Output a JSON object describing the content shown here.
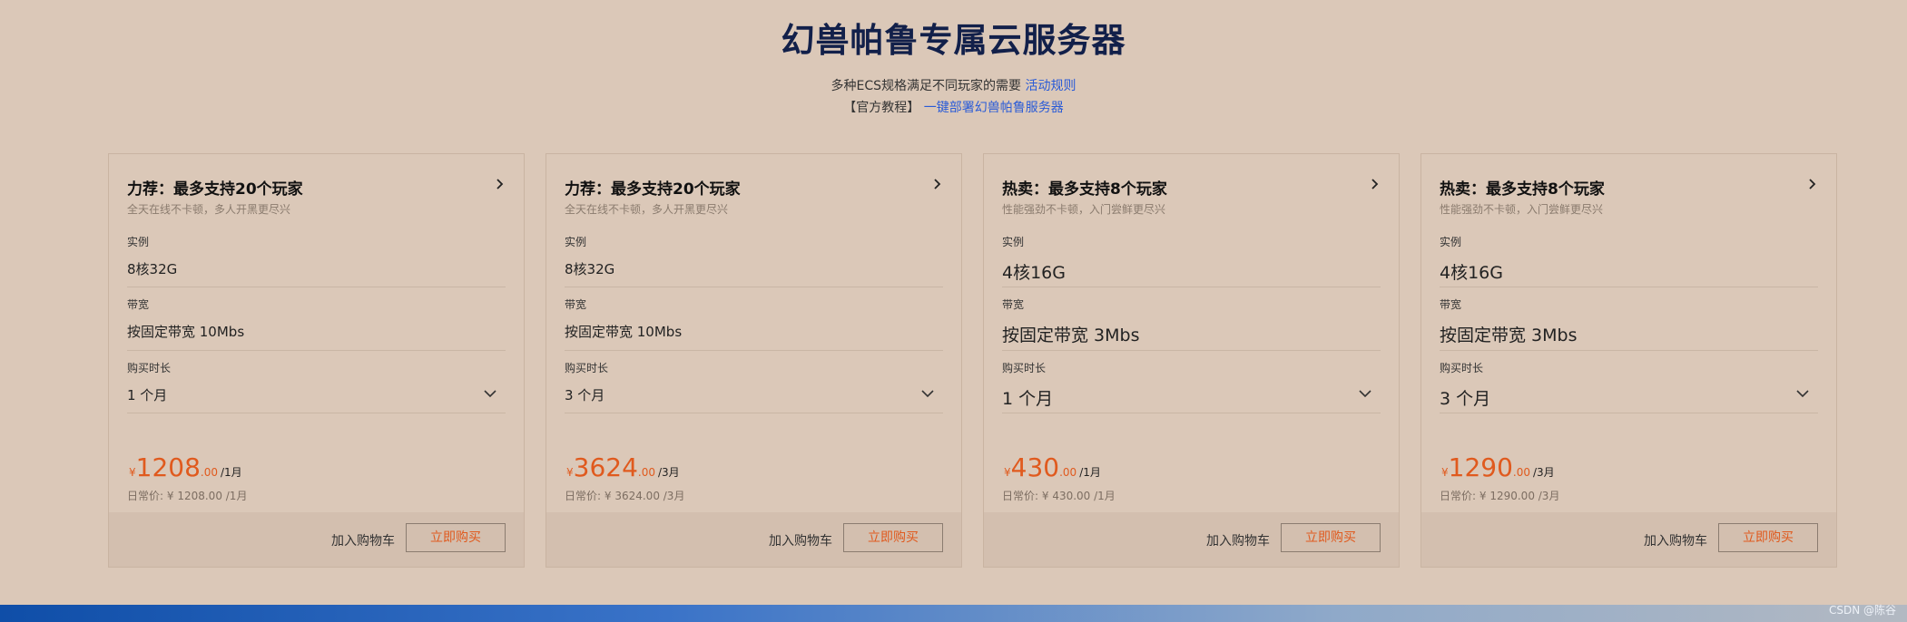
{
  "header": {
    "title": "幻兽帕鲁专属云服务器",
    "subtitle_text": "多种ECS规格满足不同玩家的需要",
    "subtitle_link": "活动规则",
    "tutorial_prefix": "【官方教程】",
    "tutorial_link": "一键部署幻兽帕鲁服务器"
  },
  "labels": {
    "instance": "实例",
    "bandwidth": "带宽",
    "duration": "购买时长",
    "daily_prefix": "日常价:",
    "add_to_cart": "加入购物车",
    "buy_now": "立即购买",
    "yen": "¥"
  },
  "cards": [
    {
      "title": "力荐：最多支持20个玩家",
      "desc": "全天在线不卡顿，多人开黑更尽兴",
      "instance": "8核32G",
      "bandwidth": "按固定带宽 10Mbs",
      "duration": "1 个月",
      "price_int": "1208",
      "price_dec": ".00",
      "price_unit": "/1月",
      "daily_value": "¥ 1208.00 /1月"
    },
    {
      "title": "力荐：最多支持20个玩家",
      "desc": "全天在线不卡顿，多人开黑更尽兴",
      "instance": "8核32G",
      "bandwidth": "按固定带宽 10Mbs",
      "duration": "3 个月",
      "price_int": "3624",
      "price_dec": ".00",
      "price_unit": "/3月",
      "daily_value": "¥ 3624.00 /3月"
    },
    {
      "title": "热卖：最多支持8个玩家",
      "desc": "性能强劲不卡顿，入门尝鲜更尽兴",
      "instance": "4核16G",
      "bandwidth": "按固定带宽 3Mbs",
      "duration": "1 个月",
      "price_int": "430",
      "price_dec": ".00",
      "price_unit": "/1月",
      "daily_value": "¥ 430.00 /1月"
    },
    {
      "title": "热卖：最多支持8个玩家",
      "desc": "性能强劲不卡顿，入门尝鲜更尽兴",
      "instance": "4核16G",
      "bandwidth": "按固定带宽 3Mbs",
      "duration": "3 个月",
      "price_int": "1290",
      "price_dec": ".00",
      "price_unit": "/3月",
      "daily_value": "¥ 1290.00 /3月"
    }
  ],
  "watermark": "CSDN @陈谷",
  "colors": {
    "background": "#dbc8b8",
    "title": "#12204a",
    "link": "#2a5bd7",
    "price": "#e05a1e"
  }
}
